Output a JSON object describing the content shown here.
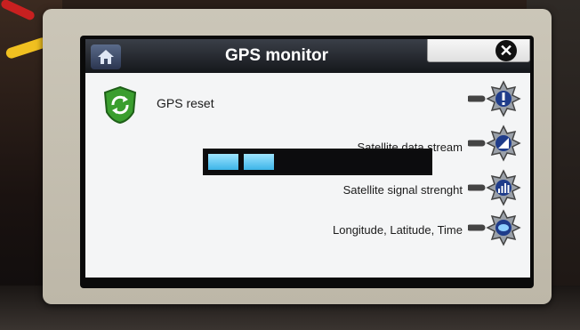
{
  "window": {
    "title": "GPS monitor"
  },
  "header": {
    "home_icon": "home-icon",
    "close_icon": "close-icon"
  },
  "actions": {
    "reset": {
      "label": "GPS reset",
      "icon": "refresh-shield-icon"
    }
  },
  "rows": [
    {
      "label": "Satellite data stream",
      "icon": "gear-antenna-icon"
    },
    {
      "label": "Satellite signal strenght",
      "icon": "gear-bars-icon"
    },
    {
      "label": "Longitude, Latitude, Time",
      "icon": "gear-globe-icon"
    }
  ],
  "progress": {
    "fraction": 0.28,
    "segments_filled": 2
  },
  "colors": {
    "titlebar": "#15171b",
    "accent": "#3cb4e8",
    "reset_green": "#3a9e2e"
  }
}
